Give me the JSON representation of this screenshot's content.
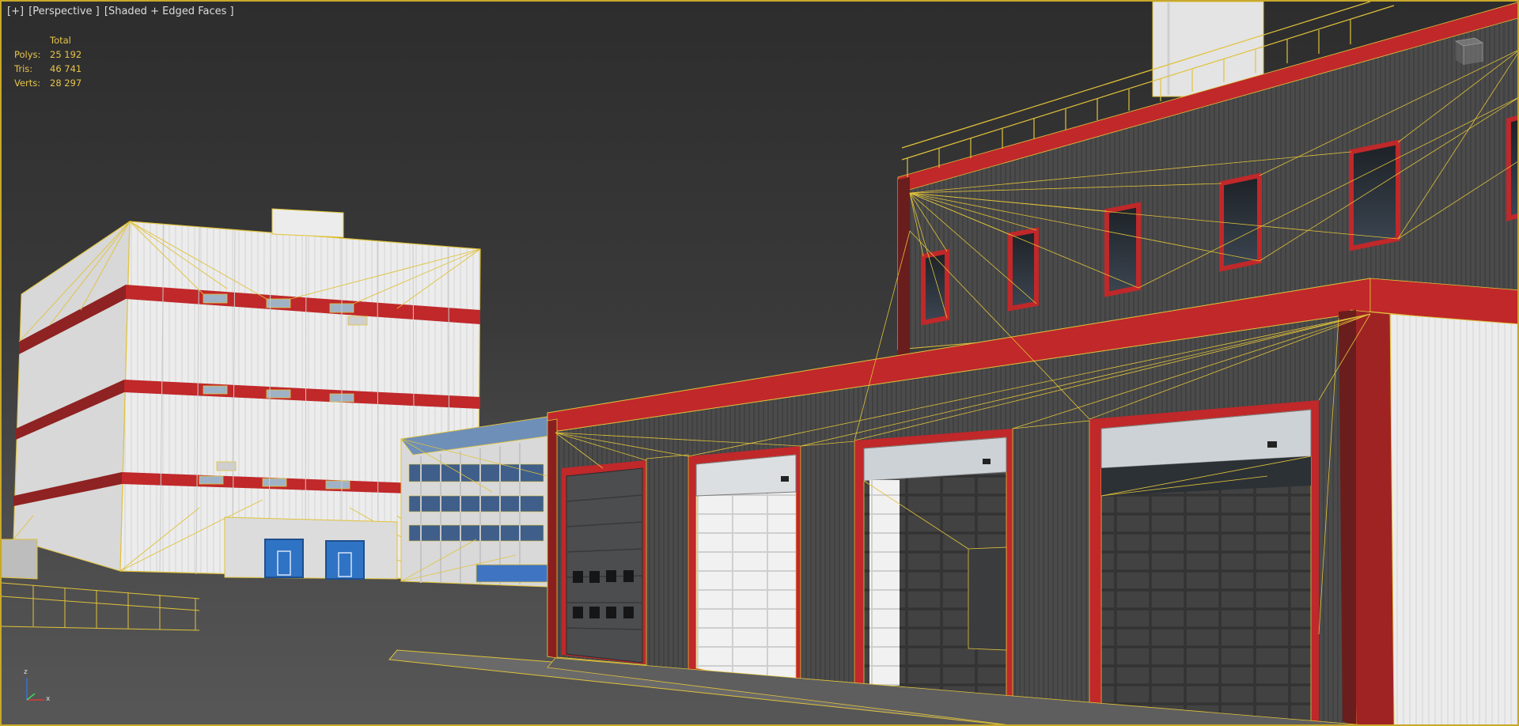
{
  "viewport": {
    "plus_menu": "[+]",
    "view_menu": "[Perspective ]",
    "shading_menu": "[Shaded + Edged Faces ]"
  },
  "stats": {
    "header": "Total",
    "rows": [
      {
        "label": "Polys:",
        "value": "25 192"
      },
      {
        "label": "Tris:",
        "value": "46 741"
      },
      {
        "label": "Verts:",
        "value": "28 297"
      }
    ]
  },
  "axis": {
    "z": "z",
    "x": "x"
  },
  "colors": {
    "selection_edges": "#e0c23a",
    "trim_red": "#c0282a",
    "cladding_dark": "#4a4a4a",
    "cladding_white": "#e9eaea",
    "door_blue": "#2f73c5",
    "viewport_border": "#c8a82a"
  },
  "icons": {
    "viewcube": "viewcube-icon",
    "axis_tripod": "axis-tripod-icon"
  }
}
